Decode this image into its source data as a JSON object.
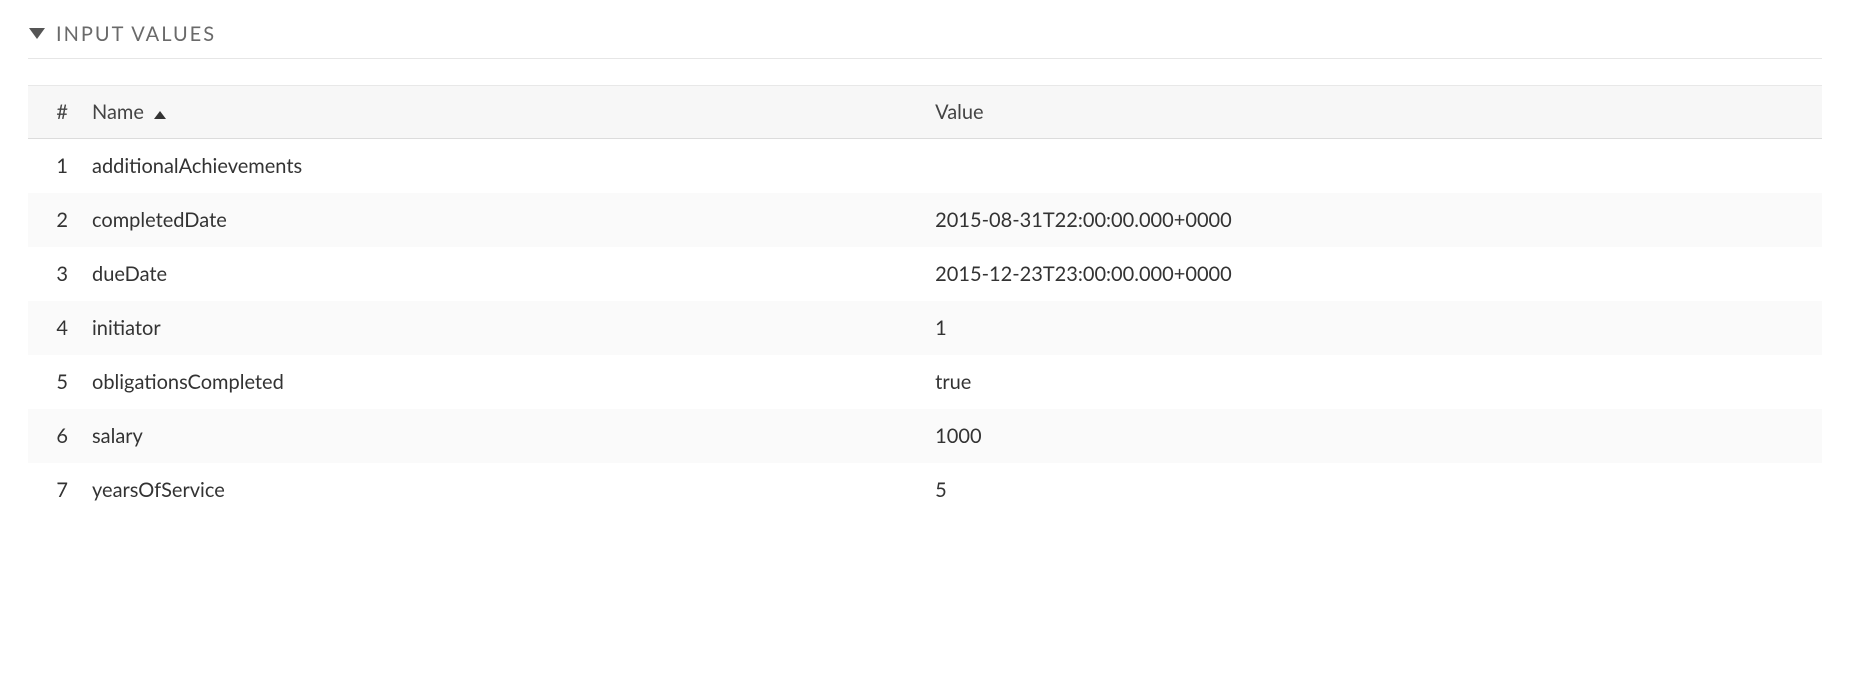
{
  "section": {
    "title": "INPUT VALUES"
  },
  "table": {
    "headers": {
      "index": "#",
      "name": "Name",
      "value": "Value"
    },
    "sort": {
      "column": "name",
      "direction": "asc"
    },
    "rows": [
      {
        "index": "1",
        "name": "additionalAchievements",
        "value": ""
      },
      {
        "index": "2",
        "name": "completedDate",
        "value": "2015-08-31T22:00:00.000+0000"
      },
      {
        "index": "3",
        "name": "dueDate",
        "value": "2015-12-23T23:00:00.000+0000"
      },
      {
        "index": "4",
        "name": "initiator",
        "value": "1"
      },
      {
        "index": "5",
        "name": "obligationsCompleted",
        "value": "true"
      },
      {
        "index": "6",
        "name": "salary",
        "value": "1000"
      },
      {
        "index": "7",
        "name": "yearsOfService",
        "value": "5"
      }
    ]
  }
}
